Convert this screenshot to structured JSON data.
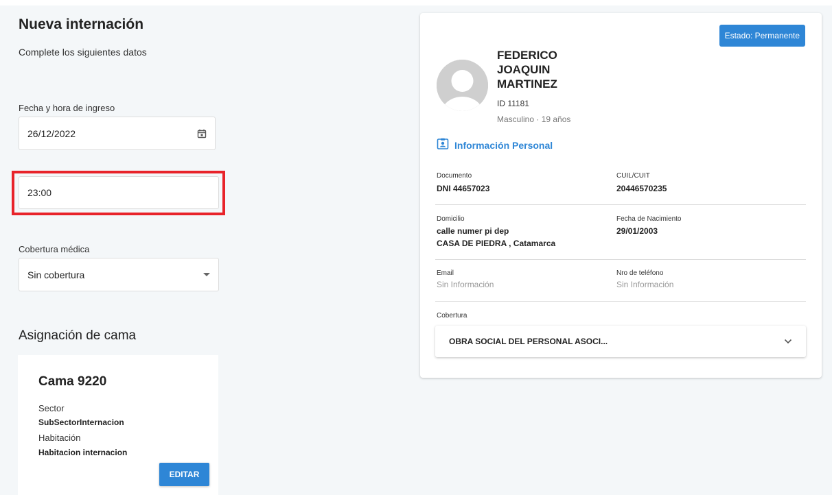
{
  "form": {
    "title": "Nueva internación",
    "subtitle": "Complete los siguientes datos",
    "date_label": "Fecha y hora de ingreso",
    "date_value": "26/12/2022",
    "time_value": "23:00",
    "coverage_label": "Cobertura médica",
    "coverage_value": "Sin cobertura",
    "bed_section_title": "Asignación de cama"
  },
  "bed": {
    "title": "Cama 9220",
    "sector_label": "Sector",
    "sector_value": "SubSectorInternacion",
    "room_label": "Habitación",
    "room_value": "Habitacion internacion",
    "edit_label": "EDITAR"
  },
  "patient": {
    "status": "Estado: Permanente",
    "name_lines": [
      "FEDERICO",
      "JOAQUIN",
      "MARTINEZ"
    ],
    "id": "ID 11181",
    "meta": "Masculino · 19 años",
    "section_title": "Información Personal",
    "documento_label": "Documento",
    "documento_value": "DNI 44657023",
    "cuil_label": "CUIL/CUIT",
    "cuil_value": "20446570235",
    "domicilio_label": "Domicilio",
    "domicilio_line1": "calle numer pi dep",
    "domicilio_line2": "CASA DE PIEDRA , Catamarca",
    "nacimiento_label": "Fecha de Nacimiento",
    "nacimiento_value": "29/01/2003",
    "email_label": "Email",
    "email_value": "Sin Información",
    "telefono_label": "Nro de teléfono",
    "telefono_value": "Sin Información",
    "cobertura_label": "Cobertura",
    "cobertura_value": "OBRA SOCIAL DEL PERSONAL ASOCI..."
  },
  "colors": {
    "accent": "#2e86d6",
    "highlight": "#e8232a",
    "background": "#f4f7f9"
  },
  "icons": {
    "date_picker": "calendar-icon",
    "coverage_select": "dropdown-arrow-icon",
    "avatar": "person-placeholder-icon",
    "personal_info": "id-badge-icon",
    "coverage_expand": "chevron-down-icon"
  }
}
